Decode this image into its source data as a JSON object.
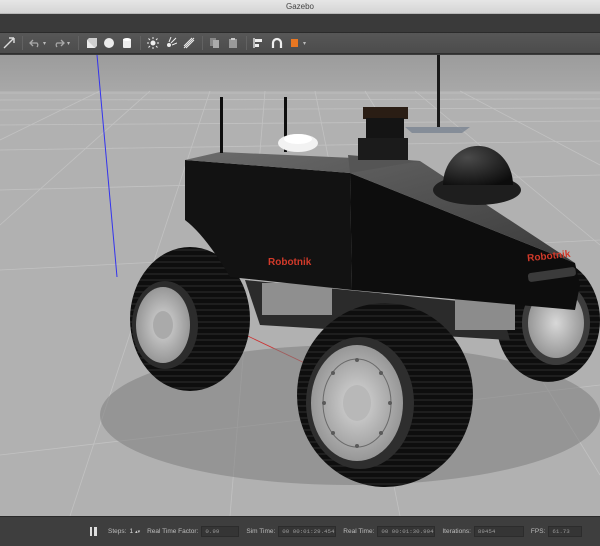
{
  "window": {
    "title": "Gazebo"
  },
  "toolbar": {
    "icons": [
      "arrow-icon",
      "undo-icon",
      "redo-icon",
      "box-icon",
      "sphere-icon",
      "cylinder-icon",
      "sun-icon",
      "point-light-icon",
      "spot-light-icon",
      "copy-icon",
      "paste-icon",
      "align-icon",
      "snap-icon",
      "color-icon"
    ]
  },
  "viewport": {
    "robot_brand": "Robotnik",
    "ground_color": "#b1b1b1",
    "robot_color": "#111111",
    "brand_color": "#d23a2a"
  },
  "status": {
    "steps_label": "Steps:",
    "steps_value": "1",
    "real_time_factor_label": "Real Time Factor:",
    "real_time_factor_value": "0.99",
    "sim_time_label": "Sim Time:",
    "sim_time_value": "00 00:01:29.454",
    "real_time_label": "Real Time:",
    "real_time_value": "00 00:01:30.904",
    "iterations_label": "Iterations:",
    "iterations_value": "89454",
    "fps_label": "FPS:",
    "fps_value": "61.73"
  }
}
